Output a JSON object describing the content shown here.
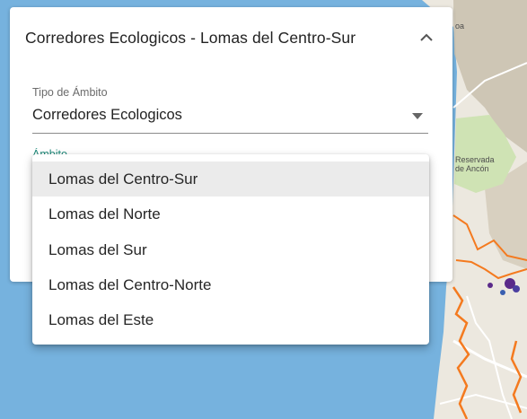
{
  "card": {
    "title": "Corredores Ecologicos - Lomas del Centro-Sur"
  },
  "scope_type": {
    "label": "Tipo de Ámbito",
    "value": "Corredores Ecologicos"
  },
  "scope": {
    "label": "Ámbito"
  },
  "dropdown": {
    "options": [
      {
        "label": "Lomas del Centro-Sur",
        "selected": true
      },
      {
        "label": "Lomas del Norte",
        "selected": false
      },
      {
        "label": "Lomas del Sur",
        "selected": false
      },
      {
        "label": "Lomas del Centro-Norte",
        "selected": false
      },
      {
        "label": "Lomas del Este",
        "selected": false
      }
    ]
  },
  "map": {
    "labels": [
      "Reservada",
      "de Ancón",
      "oa"
    ]
  },
  "colors": {
    "sea": "#76b2de",
    "land": "#ece8df",
    "hills": "#c9bfae",
    "reserve": "#cfe3b4",
    "corridor": "#f47a1f",
    "cluster": "#5a2a8a",
    "accent": "#1f8a7a"
  }
}
